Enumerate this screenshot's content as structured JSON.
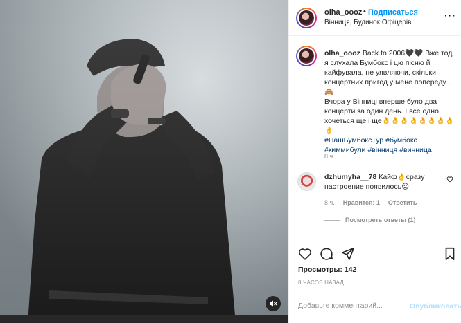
{
  "post": {
    "username": "olha_oooz",
    "follow_label": "Подписаться",
    "separator": "•",
    "location": "Вінниця, Будинок Офіцерів",
    "more_label": "···"
  },
  "caption": {
    "username": "olha_oooz",
    "text_1": " Back to 2006🖤🖤 Вже тоді я слухала Бумбокс і цю пісню й кайфувала, не уявляючи, скільки концертних пригод у мене попереду...🙈",
    "text_2": "Вчора у Вінниці вперше було два концерти за один день. І все одно хочеться ще і ще👌👌👌👌👌👌👌👌👌",
    "hashtags": [
      "#НашБумбоксТур",
      "#бумбокс",
      "#киммибули",
      "#вінниця",
      "#винница"
    ],
    "time": "8 ч."
  },
  "comment": {
    "username": "dzhumyha__78",
    "text": " Кайф👌сразу настроение появилось😍",
    "time": "8 ч.",
    "likes": "Нравится: 1",
    "reply": "Ответить",
    "view_replies": "Посмотреть ответы (1)"
  },
  "stats": {
    "views": "Просмотры: 142",
    "age": "8 ЧАСОВ НАЗАД"
  },
  "add_comment": {
    "placeholder": "Добавьте комментарий...",
    "post_label": "Опубликовать"
  },
  "icons": [
    "heart-icon",
    "comment-icon",
    "share-icon",
    "bookmark-icon",
    "mute-icon",
    "more-icon"
  ],
  "colors": {
    "link": "#0095f6",
    "hashtag": "#00376b",
    "muted": "#8e8e8e",
    "post_disabled": "#b2dffc"
  }
}
